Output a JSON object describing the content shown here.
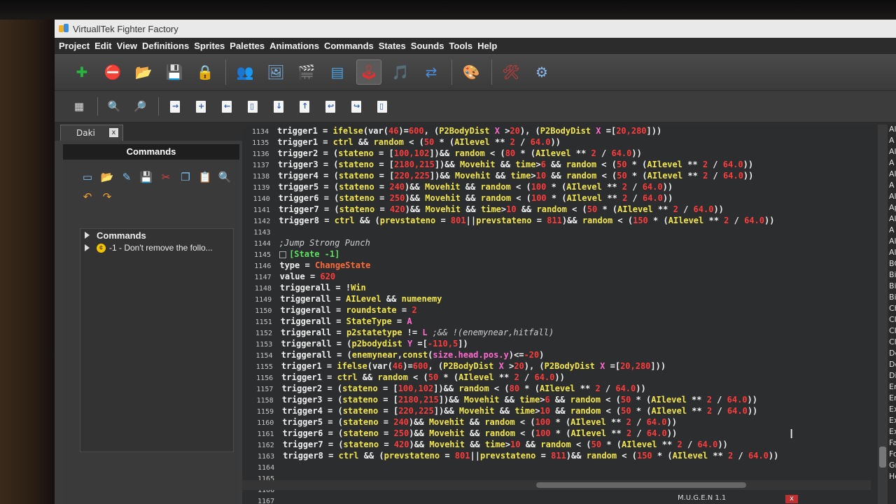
{
  "window": {
    "title": "VirtuallTek Fighter Factory"
  },
  "menu": [
    "Project",
    "Edit",
    "View",
    "Definitions",
    "Sprites",
    "Palettes",
    "Animations",
    "Commands",
    "States",
    "Sounds",
    "Tools",
    "Help"
  ],
  "toolbar_main": [
    {
      "name": "add-icon",
      "glyph": "✚",
      "color": "#27b43c"
    },
    {
      "name": "remove-icon",
      "glyph": "⛔",
      "color": "#e23030"
    },
    {
      "name": "open-folder-icon",
      "glyph": "📂",
      "color": "#5aa8e6"
    },
    {
      "name": "save-icon",
      "glyph": "💾",
      "color": "#bbbbbb"
    },
    {
      "name": "lock-icon",
      "glyph": "🔒",
      "color": "#f2c200"
    },
    {
      "name": "characters-icon",
      "glyph": "👥",
      "color": "#e7b27a"
    },
    {
      "name": "sprites-icon",
      "glyph": "🖼",
      "color": "#7fb8e8"
    },
    {
      "name": "animations-icon",
      "glyph": "🎬",
      "color": "#e23030"
    },
    {
      "name": "states-icon",
      "glyph": "▤",
      "color": "#4aa3e0"
    },
    {
      "name": "commands-joystick-icon",
      "glyph": "🕹",
      "color": "#e23030"
    },
    {
      "name": "sounds-icon",
      "glyph": "🎵",
      "color": "#2ab44a"
    },
    {
      "name": "export-icon",
      "glyph": "⇄",
      "color": "#4a8de0"
    },
    {
      "name": "palette-icon",
      "glyph": "🎨",
      "color": "#f2b400"
    },
    {
      "name": "tools-icon",
      "glyph": "🛠",
      "color": "#e03a3a"
    },
    {
      "name": "settings-icon",
      "glyph": "⚙",
      "color": "#8ab8f0"
    }
  ],
  "toolbar_secondary": [
    {
      "name": "calculator-icon",
      "glyph": "▦"
    },
    {
      "name": "zoom-in-icon",
      "glyph": "🔍"
    },
    {
      "name": "zoom-search-icon",
      "glyph": "🔎"
    },
    {
      "name": "doc-arrow-icon",
      "glyph": "→"
    },
    {
      "name": "doc-plus-icon",
      "glyph": "+"
    },
    {
      "name": "doc-edit-icon",
      "glyph": "←"
    },
    {
      "name": "doc-icon",
      "glyph": "▯"
    },
    {
      "name": "doc-down-icon",
      "glyph": "↓"
    },
    {
      "name": "doc-up-icon",
      "glyph": "↑"
    },
    {
      "name": "doc-back-icon",
      "glyph": "↩"
    },
    {
      "name": "doc-fwd-icon",
      "glyph": "↪"
    },
    {
      "name": "doc-blank-icon",
      "glyph": "▯"
    }
  ],
  "tab": {
    "label": "Daki",
    "close": "x"
  },
  "panel": {
    "title": "Commands",
    "tools": [
      {
        "name": "new-icon",
        "glyph": "▭"
      },
      {
        "name": "open-icon",
        "glyph": "📂"
      },
      {
        "name": "edit-icon",
        "glyph": "✎"
      },
      {
        "name": "save-icon",
        "glyph": "💾"
      },
      {
        "name": "cut-icon",
        "glyph": "✂"
      },
      {
        "name": "copy-icon",
        "glyph": "❐"
      },
      {
        "name": "paste-icon",
        "glyph": "📋"
      },
      {
        "name": "find-icon",
        "glyph": "🔍"
      },
      {
        "name": "undo-icon",
        "glyph": "↶"
      },
      {
        "name": "redo-icon",
        "glyph": "↷"
      }
    ],
    "tree": [
      {
        "label": "Commands",
        "bold": true
      },
      {
        "label": "-1 - Don't remove the follo...",
        "coin": true
      }
    ]
  },
  "code": [
    {
      "ln": "1134",
      "html": "<span class='txt'>trigger1 = </span><span class='kw'>ifelse</span><span class='txt'>(var(</span><span class='num'>46</span><span class='txt'>)=</span><span class='num'>600</span><span class='txt'>, (</span><span class='kw'>P2BodyDist</span><span class='txt'> </span><span class='pink'>X</span><span class='txt'> &gt;</span><span class='num'>20</span><span class='txt'>), (</span><span class='kw'>P2BodyDist</span><span class='txt'> </span><span class='pink'>X</span><span class='txt'> =[</span><span class='num'>20,280</span><span class='txt'>]))</span>"
    },
    {
      "ln": "1135",
      "html": "<span class='txt'>trigger1 = </span><span class='kw'>ctrl</span><span class='txt'> &amp;&amp; </span><span class='kw'>random</span><span class='txt'> &lt; (</span><span class='num'>50</span><span class='txt'> * (</span><span class='kw'>AIlevel</span><span class='txt'> ** </span><span class='num'>2</span><span class='txt'> / </span><span class='num'>64.0</span><span class='txt'>))</span>"
    },
    {
      "ln": "1136",
      "html": "<span class='txt'>trigger2 = (</span><span class='kw'>stateno</span><span class='txt'> = [</span><span class='num'>100,102</span><span class='txt'>])&amp;&amp; </span><span class='kw'>random</span><span class='txt'> &lt; (</span><span class='num'>80</span><span class='txt'> * (</span><span class='kw'>AIlevel</span><span class='txt'> ** </span><span class='num'>2</span><span class='txt'> / </span><span class='num'>64.0</span><span class='txt'>))</span>"
    },
    {
      "ln": "1137",
      "html": "<span class='txt'>trigger3 = (</span><span class='kw'>stateno</span><span class='txt'> = [</span><span class='num'>2180,215</span><span class='txt'>])&amp;&amp; </span><span class='kw'>Movehit</span><span class='txt'> &amp;&amp; </span><span class='kw'>time</span><span class='txt'>&gt;</span><span class='num'>6</span><span class='txt'> &amp;&amp; </span><span class='kw'>random</span><span class='txt'> &lt; (</span><span class='num'>50</span><span class='txt'> * (</span><span class='kw'>AIlevel</span><span class='txt'> ** </span><span class='num'>2</span><span class='txt'> / </span><span class='num'>64.0</span><span class='txt'>))</span>"
    },
    {
      "ln": "1138",
      "html": "<span class='txt'>trigger4 = (</span><span class='kw'>stateno</span><span class='txt'> = [</span><span class='num'>220,225</span><span class='txt'>])&amp;&amp; </span><span class='kw'>Movehit</span><span class='txt'> &amp;&amp; </span><span class='kw'>time</span><span class='txt'>&gt;</span><span class='num'>10</span><span class='txt'> &amp;&amp; </span><span class='kw'>random</span><span class='txt'> &lt; (</span><span class='num'>50</span><span class='txt'> * (</span><span class='kw'>AIlevel</span><span class='txt'> ** </span><span class='num'>2</span><span class='txt'> / </span><span class='num'>64.0</span><span class='txt'>))</span>"
    },
    {
      "ln": "1139",
      "html": "<span class='txt'>trigger5 = (</span><span class='kw'>stateno</span><span class='txt'> = </span><span class='num'>240</span><span class='txt'>)&amp;&amp; </span><span class='kw'>Movehit</span><span class='txt'> &amp;&amp; </span><span class='kw'>random</span><span class='txt'> &lt; (</span><span class='num'>100</span><span class='txt'> * (</span><span class='kw'>AIlevel</span><span class='txt'> ** </span><span class='num'>2</span><span class='txt'> / </span><span class='num'>64.0</span><span class='txt'>))</span>"
    },
    {
      "ln": "1140",
      "html": "<span class='txt'>trigger6 = (</span><span class='kw'>stateno</span><span class='txt'> = </span><span class='num'>250</span><span class='txt'>)&amp;&amp; </span><span class='kw'>Movehit</span><span class='txt'> &amp;&amp; </span><span class='kw'>random</span><span class='txt'> &lt; (</span><span class='num'>100</span><span class='txt'> * (</span><span class='kw'>AIlevel</span><span class='txt'> ** </span><span class='num'>2</span><span class='txt'> / </span><span class='num'>64.0</span><span class='txt'>))</span>"
    },
    {
      "ln": "1141",
      "html": "<span class='txt'>trigger7 = (</span><span class='kw'>stateno</span><span class='txt'> = </span><span class='num'>420</span><span class='txt'>)&amp;&amp; </span><span class='kw'>Movehit</span><span class='txt'> &amp;&amp; </span><span class='kw'>time</span><span class='txt'>&gt;</span><span class='num'>10</span><span class='txt'> &amp;&amp; </span><span class='kw'>random</span><span class='txt'> &lt; (</span><span class='num'>50</span><span class='txt'> * (</span><span class='kw'>AIlevel</span><span class='txt'> ** </span><span class='num'>2</span><span class='txt'> / </span><span class='num'>64.0</span><span class='txt'>))</span>"
    },
    {
      "ln": "1142",
      "html": "<span class='txt'>trigger8 = </span><span class='kw'>ctrl</span><span class='txt'> &amp;&amp; (</span><span class='kw'>prevstateno</span><span class='txt'> = </span><span class='num'>801</span><span class='txt'>||</span><span class='kw'>prevstateno</span><span class='txt'> = </span><span class='num'>811</span><span class='txt'>)&amp;&amp; </span><span class='kw'>random</span><span class='txt'> &lt; (</span><span class='num'>150</span><span class='txt'> * (</span><span class='kw'>AIlevel</span><span class='txt'> ** </span><span class='num'>2</span><span class='txt'> / </span><span class='num'>64.0</span><span class='txt'>))</span>"
    },
    {
      "ln": "1143",
      "html": ""
    },
    {
      "ln": "1144",
      "html": "<span class='cmt'>;Jump Strong Punch</span>"
    },
    {
      "ln": "1145",
      "html": "<span class='sect'>[State -1]</span>",
      "fold": true
    },
    {
      "ln": "1146",
      "html": "<span class='txt'>type = </span><span class='str'>ChangeState</span>"
    },
    {
      "ln": "1147",
      "html": "<span class='txt'>value = </span><span class='num'>620</span>"
    },
    {
      "ln": "1148",
      "html": "<span class='txt'>triggerall = !</span><span class='kw'>Win</span>"
    },
    {
      "ln": "1149",
      "html": "<span class='txt'>triggerall = </span><span class='kw'>AILevel</span><span class='txt'> &amp;&amp; </span><span class='kw'>numenemy</span>"
    },
    {
      "ln": "1150",
      "html": "<span class='txt'>triggerall = </span><span class='kw'>roundstate</span><span class='txt'> = </span><span class='num'>2</span>"
    },
    {
      "ln": "1151",
      "html": "<span class='txt'>triggerall = </span><span class='kw'>StateType</span><span class='txt'> = </span><span class='pink'>A</span>"
    },
    {
      "ln": "1152",
      "html": "<span class='txt'>triggerall = </span><span class='kw'>p2statetype</span><span class='txt'> != </span><span class='pink'>L</span><span class='cmt'> ;&amp;&amp; !(enemynear,hitfall)</span>"
    },
    {
      "ln": "1153",
      "html": "<span class='txt'>triggerall = (</span><span class='kw'>p2bodydist</span><span class='txt'> </span><span class='pink'>Y</span><span class='txt'> =[</span><span class='num'>-110,5</span><span class='txt'>])</span>"
    },
    {
      "ln": "1154",
      "html": "<span class='txt'>triggerall = (</span><span class='kw'>enemynear</span><span class='txt'>,</span><span class='kw'>const</span><span class='txt'>(</span><span class='pink'>size.head.pos.y</span><span class='txt'>)&lt;=</span><span class='num'>-20</span><span class='txt'>)</span>"
    },
    {
      "ln": "1155",
      "html": "<span class='txt'>trigger1 = </span><span class='kw'>ifelse</span><span class='txt'>(var(</span><span class='num'>46</span><span class='txt'>)=</span><span class='num'>600</span><span class='txt'>, (</span><span class='kw'>P2BodyDist</span><span class='txt'> </span><span class='pink'>X</span><span class='txt'> &gt;</span><span class='num'>20</span><span class='txt'>), (</span><span class='kw'>P2BodyDist</span><span class='txt'> </span><span class='pink'>X</span><span class='txt'> =[</span><span class='num'>20,280</span><span class='txt'>]))</span>"
    },
    {
      "ln": "1156",
      "html": "<span class='txt'>trigger1 = </span><span class='kw'>ctrl</span><span class='txt'> &amp;&amp; </span><span class='kw'>random</span><span class='txt'> &lt; (</span><span class='num'>50</span><span class='txt'> * (</span><span class='kw'>AIlevel</span><span class='txt'> ** </span><span class='num'>2</span><span class='txt'> / </span><span class='num'>64.0</span><span class='txt'>))</span>"
    },
    {
      "ln": "1157",
      "html": "<span class='txt'>trigger2 = (</span><span class='kw'>stateno</span><span class='txt'> = [</span><span class='num'>100,102</span><span class='txt'>])&amp;&amp; </span><span class='kw'>random</span><span class='txt'> &lt; (</span><span class='num'>80</span><span class='txt'> * (</span><span class='kw'>AIlevel</span><span class='txt'> ** </span><span class='num'>2</span><span class='txt'> / </span><span class='num'>64.0</span><span class='txt'>))</span>"
    },
    {
      "ln": "1158",
      "html": "<span class='txt'>trigger3 = (</span><span class='kw'>stateno</span><span class='txt'> = [</span><span class='num'>2180,215</span><span class='txt'>])&amp;&amp; </span><span class='kw'>Movehit</span><span class='txt'> &amp;&amp; </span><span class='kw'>time</span><span class='txt'>&gt;</span><span class='num'>6</span><span class='txt'> &amp;&amp; </span><span class='kw'>random</span><span class='txt'> &lt; (</span><span class='num'>50</span><span class='txt'> * (</span><span class='kw'>AIlevel</span><span class='txt'> ** </span><span class='num'>2</span><span class='txt'> / </span><span class='num'>64.0</span><span class='txt'>))</span>"
    },
    {
      "ln": "1159",
      "html": "<span class='txt'>trigger4 = (</span><span class='kw'>stateno</span><span class='txt'> = [</span><span class='num'>220,225</span><span class='txt'>])&amp;&amp; </span><span class='kw'>Movehit</span><span class='txt'> &amp;&amp; </span><span class='kw'>time</span><span class='txt'>&gt;</span><span class='num'>10</span><span class='txt'> &amp;&amp; </span><span class='kw'>random</span><span class='txt'> &lt; (</span><span class='num'>50</span><span class='txt'> * (</span><span class='kw'>AIlevel</span><span class='txt'> ** </span><span class='num'>2</span><span class='txt'> / </span><span class='num'>64.0</span><span class='txt'>))</span>"
    },
    {
      "ln": "1160",
      "html": "<span class='txt'>trigger5 = (</span><span class='kw'>stateno</span><span class='txt'> = </span><span class='num'>240</span><span class='txt'>)&amp;&amp; </span><span class='kw'>Movehit</span><span class='txt'> &amp;&amp; </span><span class='kw'>random</span><span class='txt'> &lt; (</span><span class='num'>100</span><span class='txt'> * (</span><span class='kw'>AIlevel</span><span class='txt'> ** </span><span class='num'>2</span><span class='txt'> / </span><span class='num'>64.0</span><span class='txt'>))</span>"
    },
    {
      "ln": "1161",
      "html": "<span class='txt'>trigger6 = (</span><span class='kw'>stateno</span><span class='txt'> = </span><span class='num'>250</span><span class='txt'>)&amp;&amp; </span><span class='kw'>Movehit</span><span class='txt'> &amp;&amp; </span><span class='kw'>random</span><span class='txt'> &lt; (</span><span class='num'>100</span><span class='txt'> * (</span><span class='kw'>AIlevel</span><span class='txt'> ** </span><span class='num'>2</span><span class='txt'> / </span><span class='num'>64.0</span><span class='txt'>))</span>"
    },
    {
      "ln": "1162",
      "html": "<span class='txt'>trigger7 = (</span><span class='kw'>stateno</span><span class='txt'> = </span><span class='num'>420</span><span class='txt'>)&amp;&amp; </span><span class='kw'>Movehit</span><span class='txt'> &amp;&amp; </span><span class='kw'>time</span><span class='txt'>&gt;</span><span class='num'>10</span><span class='txt'> &amp;&amp; </span><span class='kw'>random</span><span class='txt'> &lt; (</span><span class='num'>50</span><span class='txt'> * (</span><span class='kw'>AIlevel</span><span class='txt'> ** </span><span class='num'>2</span><span class='txt'> / </span><span class='num'>64.0</span><span class='txt'>))</span>"
    },
    {
      "ln": "1163",
      "html": "<span class='txt'>trigger8 = </span><span class='kw'>ctrl</span><span class='txt'> &amp;&amp; (</span><span class='kw'>prevstateno</span><span class='txt'> = </span><span class='num'>801</span><span class='txt'>||</span><span class='kw'>prevstateno</span><span class='txt'> = </span><span class='num'>811</span><span class='txt'>)&amp;&amp; </span><span class='kw'>random</span><span class='txt'> &lt; (</span><span class='num'>150</span><span class='txt'> * (</span><span class='kw'>AIlevel</span><span class='txt'> ** </span><span class='num'>2</span><span class='txt'> / </span><span class='num'>64.0</span><span class='txt'>))</span>"
    },
    {
      "ln": "1164",
      "html": ""
    },
    {
      "ln": "1165",
      "html": ""
    },
    {
      "ln": "1166",
      "html": ""
    },
    {
      "ln": "1167",
      "html": ""
    }
  ],
  "right_panel_items": [
    "Al",
    "A",
    "Al",
    "A",
    "Al",
    "A",
    "Al",
    "Ap",
    "Al",
    "A",
    "Al",
    "Al",
    "BG",
    "Bir",
    "Bir",
    "Bir",
    "Ch",
    "Cl",
    "Cl",
    "Cl",
    "De",
    "De",
    "Dis",
    "En",
    "En",
    "Exp",
    "Exp",
    "Exp",
    "Fa",
    "Fo",
    "Gr",
    "He"
  ],
  "taskbar": {
    "label": "M.U.G.E.N 1.1",
    "close": "x"
  }
}
